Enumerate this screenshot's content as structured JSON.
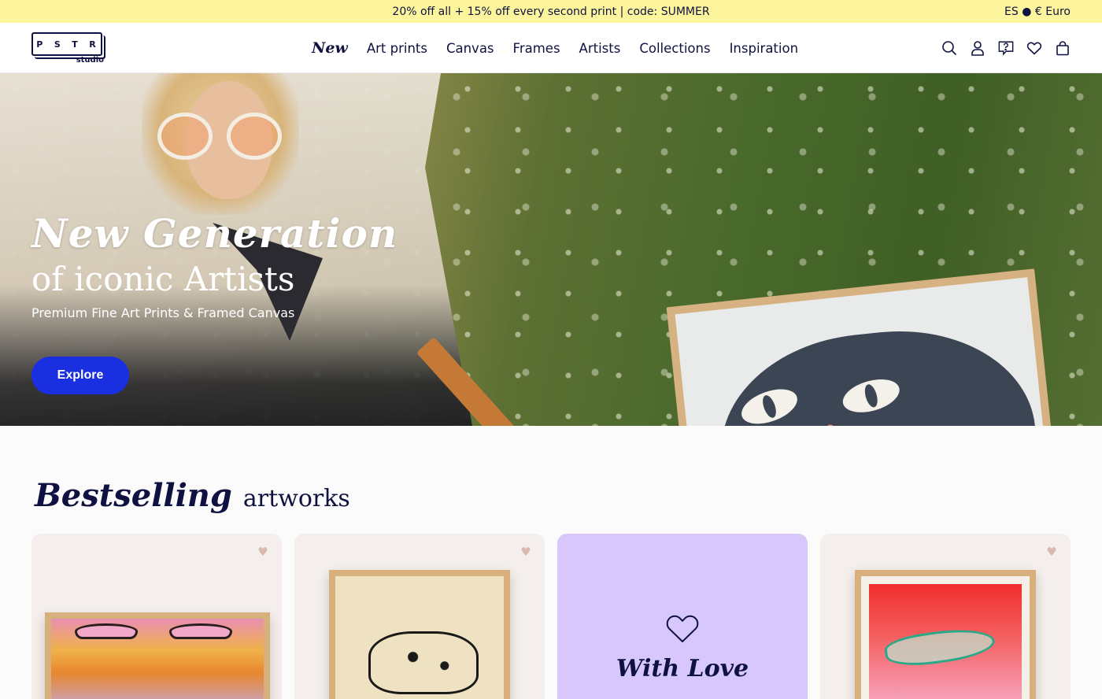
{
  "promo": {
    "text": "20% off all + 15% off every second print | code: SUMMER",
    "locale": "ES ● € Euro"
  },
  "logo": {
    "letters": [
      "P",
      "S",
      "T",
      "R"
    ],
    "sub": "studio"
  },
  "nav": {
    "items": [
      {
        "label": "New",
        "style": "script"
      },
      {
        "label": "Art prints"
      },
      {
        "label": "Canvas"
      },
      {
        "label": "Frames"
      },
      {
        "label": "Artists"
      },
      {
        "label": "Collections"
      },
      {
        "label": "Inspiration"
      }
    ]
  },
  "header_icons": [
    "search-icon",
    "account-icon",
    "help-icon",
    "wishlist-icon",
    "cart-icon"
  ],
  "hero": {
    "title_script": "New Generation",
    "title_plain": "of iconic Artists",
    "subtitle": "Premium Fine Art Prints & Framed Canvas",
    "cta": "Explore"
  },
  "bestselling": {
    "title_script": "Bestselling",
    "title_plain": "artworks",
    "cards": [
      {
        "type": "artwork",
        "heart": "heart-icon"
      },
      {
        "type": "artwork",
        "heart": "heart-icon"
      },
      {
        "type": "promo",
        "label": "With Love"
      },
      {
        "type": "artwork",
        "heart": "heart-icon"
      }
    ]
  },
  "colors": {
    "promo_bg": "#fdf59c",
    "navy": "#0f1240",
    "accent_blue": "#1a30e0",
    "love_card_bg": "#d8c7fa",
    "card_bg": "#f4efec"
  }
}
